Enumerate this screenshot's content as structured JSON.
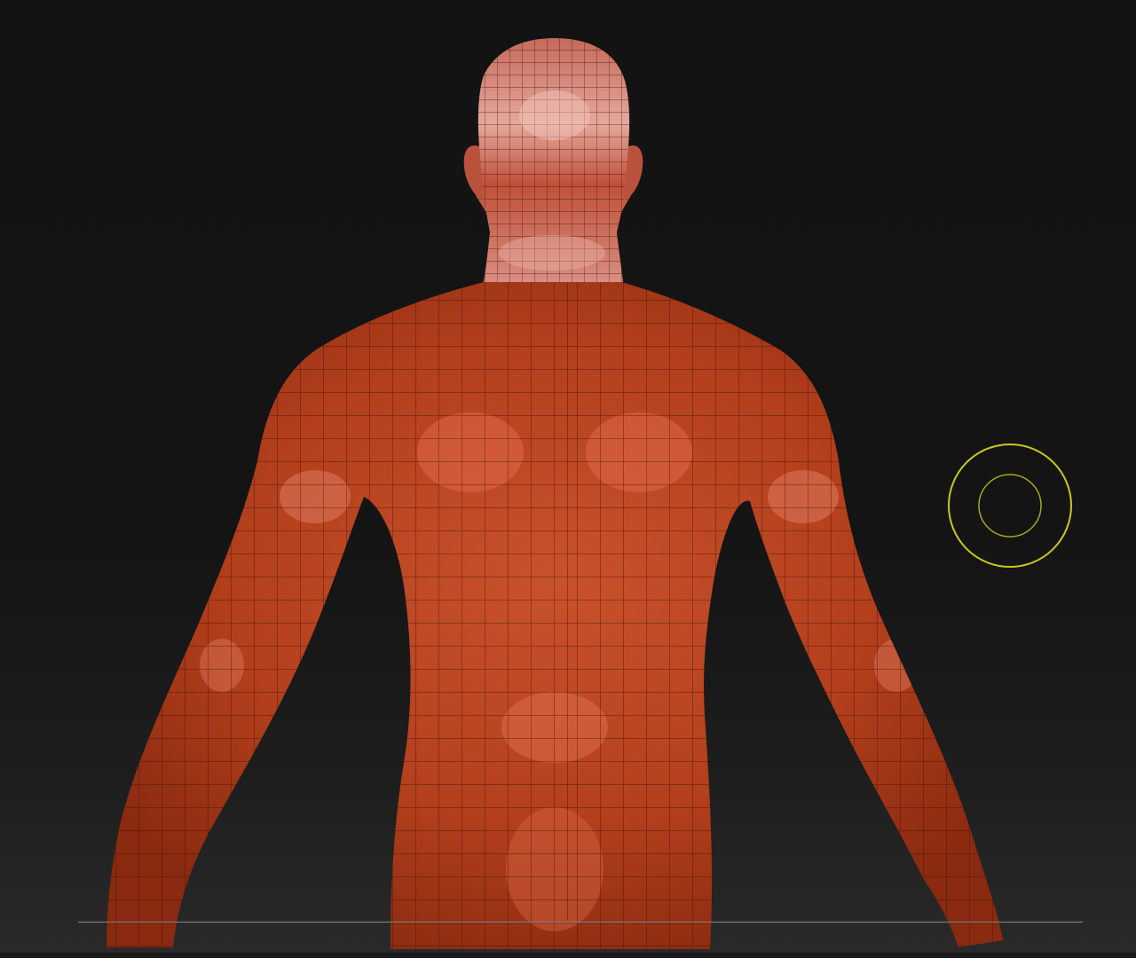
{
  "viewport": {
    "background_top": "#131313",
    "background_bottom": "#2a2a2a"
  },
  "model": {
    "material_color": "#b8401f",
    "highlight_color": "#e07a5e",
    "shadow_color": "#7a220e",
    "wire_color": "#3a0e05",
    "head_highlight": "#f0b4a8"
  },
  "brush_cursor": {
    "color": "#c8c81e",
    "icon": "brush-cursor-icon"
  },
  "floor_grid": {
    "color": "#8a8a8a"
  }
}
